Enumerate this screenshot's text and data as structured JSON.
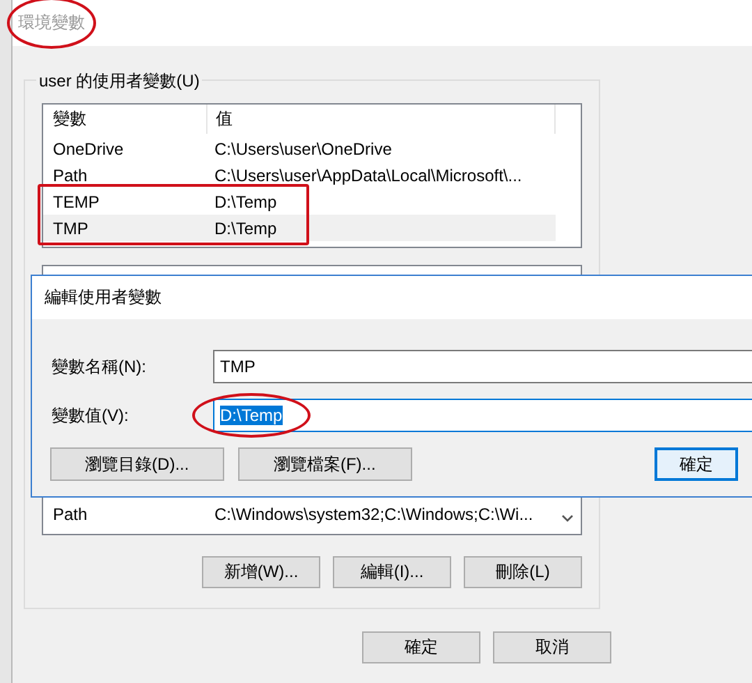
{
  "window": {
    "title": "環境變數",
    "title_circled": true
  },
  "user_variables": {
    "label": "user 的使用者變數(U)",
    "columns": [
      "變數",
      "值"
    ],
    "rows": [
      {
        "name": "OneDrive",
        "value": "C:\\Users\\user\\OneDrive",
        "selected": false,
        "marked": false
      },
      {
        "name": "Path",
        "value": "C:\\Users\\user\\AppData\\Local\\Microsoft\\...",
        "selected": false,
        "marked": false
      },
      {
        "name": "TEMP",
        "value": "D:\\Temp",
        "selected": false,
        "marked": true
      },
      {
        "name": "TMP",
        "value": "D:\\Temp",
        "selected": true,
        "marked": true
      }
    ]
  },
  "system_variables": {
    "rows": [
      {
        "name": "Path",
        "value": "C:\\Windows\\system32;C:\\Windows;C:\\Wi...",
        "selected": false
      }
    ],
    "buttons": [
      "新增(W)...",
      "編輯(I)...",
      "刪除(L)"
    ]
  },
  "buttons": [
    "確定",
    "取消"
  ],
  "edit_dialog": {
    "title": "編輯使用者變數",
    "fields": [
      {
        "label": "變數名稱(N):",
        "value": "TMP",
        "focused": false,
        "text_selected": false,
        "circled": false
      },
      {
        "label": "變數值(V):",
        "value": "D:\\Temp",
        "focused": true,
        "text_selected": true,
        "circled": true
      }
    ],
    "buttons": [
      {
        "label": "瀏覽目錄(D)...",
        "default": false
      },
      {
        "label": "瀏覽檔案(F)...",
        "default": false
      },
      {
        "label": "確定",
        "default": true
      }
    ]
  }
}
